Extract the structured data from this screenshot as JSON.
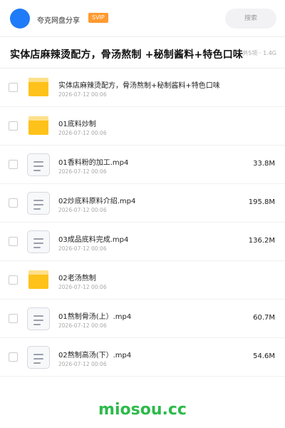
{
  "header": {
    "account_name": "夸克网盘分享",
    "badge": "SVIP",
    "avatar_color": "#1f7bf7",
    "search_placeholder": "搜索"
  },
  "title_bar": {
    "title": "实体店麻辣烫配方，骨汤熬制 +秘制酱料+特色口味",
    "meta": "共5项 · 1.4G"
  },
  "files": [
    {
      "icon": "folder-icon",
      "name": "实体店麻辣烫配方，骨汤熬制+秘制酱料+特色口味",
      "date": "2026-07-12 00:06",
      "size": ""
    },
    {
      "icon": "folder-icon",
      "name": "01底料炒制",
      "date": "2026-07-12 00:06",
      "size": ""
    },
    {
      "icon": "document-icon",
      "name": "01香料粉的加工.mp4",
      "date": "2026-07-12 00:06",
      "size": "33.8M"
    },
    {
      "icon": "document-icon",
      "name": "02炒底料原料介绍.mp4",
      "date": "2026-07-12 00:06",
      "size": "195.8M"
    },
    {
      "icon": "document-icon",
      "name": "03成品底料完成.mp4",
      "date": "2026-07-12 00:06",
      "size": "136.2M"
    },
    {
      "icon": "folder-icon",
      "name": "02老汤熬制",
      "date": "2026-07-12 00:06",
      "size": ""
    },
    {
      "icon": "document-icon",
      "name": "01熬制骨汤(上）.mp4",
      "date": "2026-07-12 00:06",
      "size": "60.7M"
    },
    {
      "icon": "document-icon",
      "name": "02熬制高汤(下）.mp4",
      "date": "2026-07-12 00:06",
      "size": "54.6M"
    }
  ],
  "footer": {
    "watermark": "miosou.cc",
    "watermark_color": "#2cba4a"
  }
}
